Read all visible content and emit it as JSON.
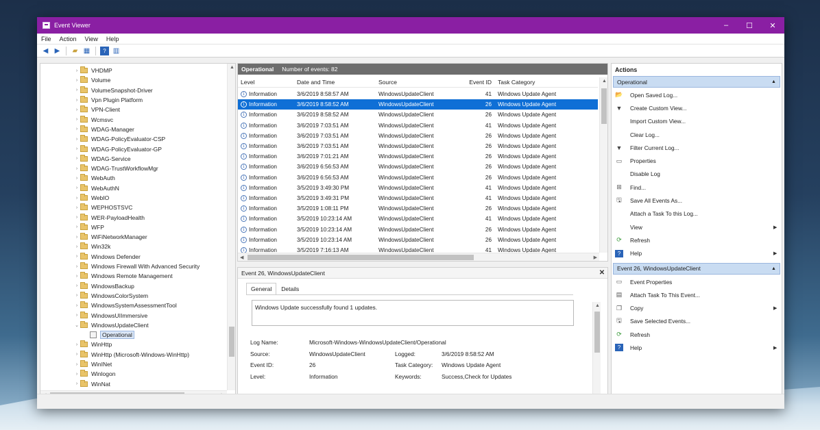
{
  "window": {
    "title": "Event Viewer",
    "minimize": "–",
    "maximize": "☐",
    "close": "✕"
  },
  "menu": [
    "File",
    "Action",
    "View",
    "Help"
  ],
  "tree": {
    "items": [
      {
        "label": "VHDMP",
        "expanded": false
      },
      {
        "label": "Volume",
        "expanded": false
      },
      {
        "label": "VolumeSnapshot-Driver",
        "expanded": false
      },
      {
        "label": "Vpn Plugin Platform",
        "expanded": false
      },
      {
        "label": "VPN-Client",
        "expanded": false
      },
      {
        "label": "Wcmsvc",
        "expanded": false
      },
      {
        "label": "WDAG-Manager",
        "expanded": false
      },
      {
        "label": "WDAG-PolicyEvaluator-CSP",
        "expanded": false
      },
      {
        "label": "WDAG-PolicyEvaluator-GP",
        "expanded": false
      },
      {
        "label": "WDAG-Service",
        "expanded": false
      },
      {
        "label": "WDAG-TrustWorkflowMgr",
        "expanded": false
      },
      {
        "label": "WebAuth",
        "expanded": false
      },
      {
        "label": "WebAuthN",
        "expanded": false
      },
      {
        "label": "WebIO",
        "expanded": false
      },
      {
        "label": "WEPHOSTSVC",
        "expanded": false
      },
      {
        "label": "WER-PayloadHealth",
        "expanded": false
      },
      {
        "label": "WFP",
        "expanded": false
      },
      {
        "label": "WiFiNetworkManager",
        "expanded": false
      },
      {
        "label": "Win32k",
        "expanded": false
      },
      {
        "label": "Windows Defender",
        "expanded": false
      },
      {
        "label": "Windows Firewall With Advanced Security",
        "expanded": false
      },
      {
        "label": "Windows Remote Management",
        "expanded": false
      },
      {
        "label": "WindowsBackup",
        "expanded": false
      },
      {
        "label": "WindowsColorSystem",
        "expanded": false
      },
      {
        "label": "WindowsSystemAssessmentTool",
        "expanded": false
      },
      {
        "label": "WindowsUIImmersive",
        "expanded": false
      },
      {
        "label": "WindowsUpdateClient",
        "expanded": true
      },
      {
        "label": "Operational",
        "child": true,
        "selected": true
      },
      {
        "label": "WinHttp",
        "expanded": false
      },
      {
        "label": "WinHttp (Microsoft-Windows-WinHttp)",
        "expanded": false
      },
      {
        "label": "WinINet",
        "expanded": false
      },
      {
        "label": "Winlogon",
        "expanded": false
      },
      {
        "label": "WinNat",
        "expanded": false
      }
    ]
  },
  "events_panel": {
    "title": "Operational",
    "count_text": "Number of events: 82",
    "columns": {
      "level": "Level",
      "date": "Date and Time",
      "source": "Source",
      "event_id": "Event ID",
      "task": "Task Category"
    },
    "rows": [
      {
        "level": "Information",
        "date": "3/6/2019 8:58:57 AM",
        "source": "WindowsUpdateClient",
        "event_id": "41",
        "task": "Windows Update Agent"
      },
      {
        "level": "Information",
        "date": "3/6/2019 8:58:52 AM",
        "source": "WindowsUpdateClient",
        "event_id": "26",
        "task": "Windows Update Agent",
        "selected": true
      },
      {
        "level": "Information",
        "date": "3/6/2019 8:58:52 AM",
        "source": "WindowsUpdateClient",
        "event_id": "26",
        "task": "Windows Update Agent"
      },
      {
        "level": "Information",
        "date": "3/6/2019 7:03:51 AM",
        "source": "WindowsUpdateClient",
        "event_id": "41",
        "task": "Windows Update Agent"
      },
      {
        "level": "Information",
        "date": "3/6/2019 7:03:51 AM",
        "source": "WindowsUpdateClient",
        "event_id": "26",
        "task": "Windows Update Agent"
      },
      {
        "level": "Information",
        "date": "3/6/2019 7:03:51 AM",
        "source": "WindowsUpdateClient",
        "event_id": "26",
        "task": "Windows Update Agent"
      },
      {
        "level": "Information",
        "date": "3/6/2019 7:01:21 AM",
        "source": "WindowsUpdateClient",
        "event_id": "26",
        "task": "Windows Update Agent"
      },
      {
        "level": "Information",
        "date": "3/6/2019 6:56:53 AM",
        "source": "WindowsUpdateClient",
        "event_id": "26",
        "task": "Windows Update Agent"
      },
      {
        "level": "Information",
        "date": "3/6/2019 6:56:53 AM",
        "source": "WindowsUpdateClient",
        "event_id": "26",
        "task": "Windows Update Agent"
      },
      {
        "level": "Information",
        "date": "3/5/2019 3:49:30 PM",
        "source": "WindowsUpdateClient",
        "event_id": "41",
        "task": "Windows Update Agent"
      },
      {
        "level": "Information",
        "date": "3/5/2019 3:49:31 PM",
        "source": "WindowsUpdateClient",
        "event_id": "41",
        "task": "Windows Update Agent"
      },
      {
        "level": "Information",
        "date": "3/5/2019 1:08:11 PM",
        "source": "WindowsUpdateClient",
        "event_id": "26",
        "task": "Windows Update Agent"
      },
      {
        "level": "Information",
        "date": "3/5/2019 10:23:14 AM",
        "source": "WindowsUpdateClient",
        "event_id": "41",
        "task": "Windows Update Agent"
      },
      {
        "level": "Information",
        "date": "3/5/2019 10:23:14 AM",
        "source": "WindowsUpdateClient",
        "event_id": "26",
        "task": "Windows Update Agent"
      },
      {
        "level": "Information",
        "date": "3/5/2019 10:23:14 AM",
        "source": "WindowsUpdateClient",
        "event_id": "26",
        "task": "Windows Update Agent"
      },
      {
        "level": "Information",
        "date": "3/5/2019 7:16:13 AM",
        "source": "WindowsUpdateClient",
        "event_id": "41",
        "task": "Windows Update Agent"
      }
    ]
  },
  "detail": {
    "title": "Event 26, WindowsUpdateClient",
    "tabs": [
      "General",
      "Details"
    ],
    "message": "Windows Update successfully found 1 updates.",
    "props": [
      {
        "k1": "Log Name:",
        "v1": "Microsoft-Windows-WindowsUpdateClient/Operational",
        "k2": "",
        "v2": ""
      },
      {
        "k1": "Source:",
        "v1": "WindowsUpdateClient",
        "k2": "Logged:",
        "v2": "3/6/2019 8:58:52 AM"
      },
      {
        "k1": "Event ID:",
        "v1": "26",
        "k2": "Task Category:",
        "v2": "Windows Update Agent"
      },
      {
        "k1": "Level:",
        "v1": "Information",
        "k2": "Keywords:",
        "v2": "Success,Check for Updates"
      }
    ]
  },
  "actions": {
    "title": "Actions",
    "section1": {
      "title": "Operational",
      "items": [
        {
          "label": "Open Saved Log...",
          "icon": "open-log-icon",
          "glyph": "📂"
        },
        {
          "label": "Create Custom View...",
          "icon": "filter-icon",
          "glyph": "▼"
        },
        {
          "label": "Import Custom View...",
          "icon": "",
          "glyph": ""
        },
        {
          "label": "Clear Log...",
          "icon": "",
          "glyph": ""
        },
        {
          "label": "Filter Current Log...",
          "icon": "filter-icon",
          "glyph": "▼"
        },
        {
          "label": "Properties",
          "icon": "properties-icon",
          "glyph": "▭"
        },
        {
          "label": "Disable Log",
          "icon": "",
          "glyph": ""
        },
        {
          "label": "Find...",
          "icon": "find-icon",
          "glyph": "⊞"
        },
        {
          "label": "Save All Events As...",
          "icon": "save-icon",
          "glyph": "🖫"
        },
        {
          "label": "Attach a Task To this Log...",
          "icon": "",
          "glyph": ""
        },
        {
          "label": "View",
          "icon": "",
          "glyph": "",
          "submenu": true
        },
        {
          "label": "Refresh",
          "icon": "refresh-icon",
          "glyph": "⟳"
        },
        {
          "label": "Help",
          "icon": "help-icon",
          "glyph": "?",
          "submenu": true
        }
      ]
    },
    "section2": {
      "title": "Event 26, WindowsUpdateClient",
      "items": [
        {
          "label": "Event Properties",
          "icon": "properties-icon",
          "glyph": "▭"
        },
        {
          "label": "Attach Task To This Event...",
          "icon": "task-icon",
          "glyph": "▤"
        },
        {
          "label": "Copy",
          "icon": "copy-icon",
          "glyph": "❐",
          "submenu": true
        },
        {
          "label": "Save Selected Events...",
          "icon": "save-icon",
          "glyph": "🖫"
        },
        {
          "label": "Refresh",
          "icon": "refresh-icon",
          "glyph": "⟳"
        },
        {
          "label": "Help",
          "icon": "help-icon",
          "glyph": "?",
          "submenu": true
        }
      ]
    }
  }
}
